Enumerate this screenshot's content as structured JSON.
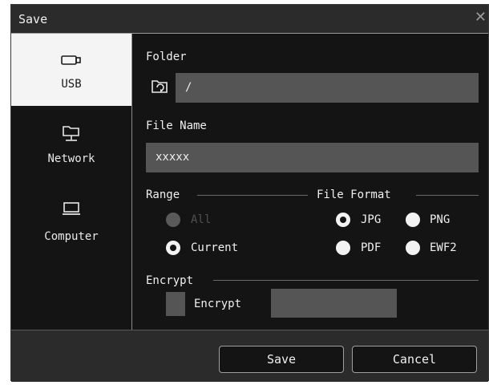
{
  "dialog": {
    "title": "Save"
  },
  "sidebar": {
    "items": [
      {
        "label": "USB",
        "icon": "usb-drive-icon",
        "active": true
      },
      {
        "label": "Network",
        "icon": "network-folder-icon",
        "active": false
      },
      {
        "label": "Computer",
        "icon": "laptop-icon",
        "active": false
      }
    ]
  },
  "folder": {
    "label": "Folder",
    "value": "/"
  },
  "file_name": {
    "label": "File Name",
    "value": "xxxxx"
  },
  "range": {
    "label": "Range",
    "options": [
      {
        "label": "All",
        "selected": false,
        "disabled": true
      },
      {
        "label": "Current",
        "selected": true,
        "disabled": false
      }
    ]
  },
  "file_format": {
    "label": "File Format",
    "options": [
      {
        "label": "JPG",
        "selected": true
      },
      {
        "label": "PNG",
        "selected": false
      },
      {
        "label": "PDF",
        "selected": false
      },
      {
        "label": "EWF2",
        "selected": false
      }
    ]
  },
  "encrypt": {
    "section_label": "Encrypt",
    "checkbox_label": "Encrypt",
    "checked": false,
    "password": ""
  },
  "footer": {
    "save_label": "Save",
    "cancel_label": "Cancel"
  },
  "colors": {
    "background": "#141414",
    "panel": "#2b2b2b",
    "field": "#555555",
    "active_tab": "#f4f4f4"
  }
}
